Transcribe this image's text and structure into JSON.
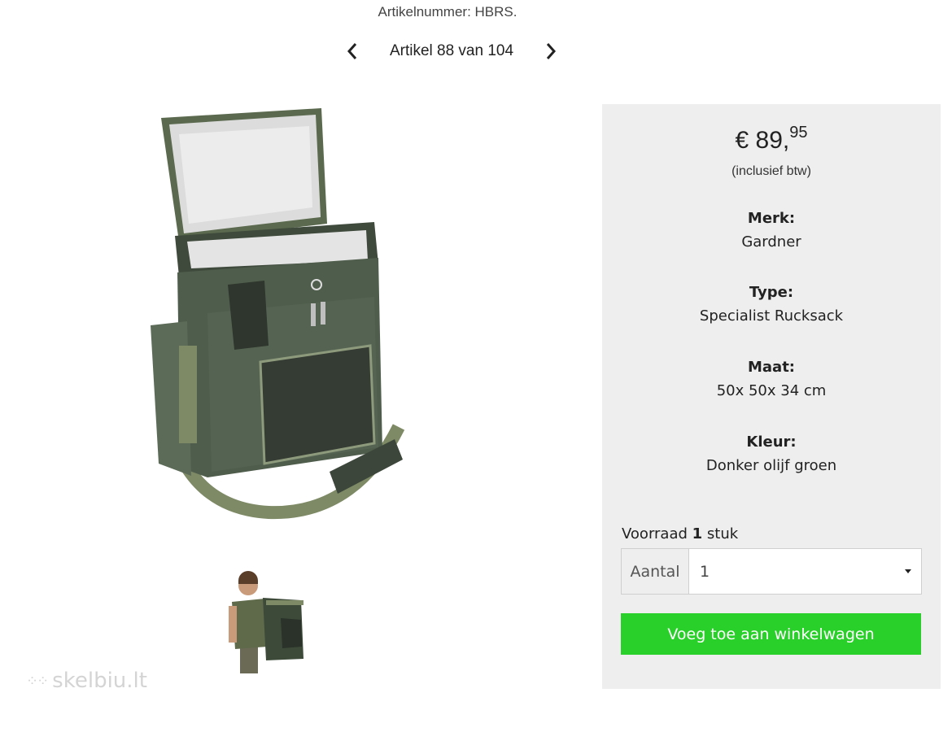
{
  "header": {
    "sku": "Artikelnummer: HBRS.",
    "pager_label": "Artikel 88 van 104"
  },
  "price": {
    "main": "€ 89,",
    "cents": "95",
    "vat_note": "(inclusief btw)"
  },
  "attributes": [
    {
      "key": "Merk:",
      "value": "Gardner"
    },
    {
      "key": "Type:",
      "value": "Specialist Rucksack"
    },
    {
      "key": "Maat:",
      "value": "50x 50x 34 cm"
    },
    {
      "key": "Kleur:",
      "value": "Donker olijf groen"
    }
  ],
  "stock": {
    "prefix": "Voorraad ",
    "count": "1",
    "unit": " stuk"
  },
  "quantity": {
    "label": "Aantal",
    "selected": "1"
  },
  "cart_button": "Voeg toe aan winkelwagen",
  "watermark": "skelbiu.lt",
  "colors": {
    "panel_bg": "#eeeeee",
    "button_green": "#2ad02a",
    "bag_green": "#4a5a4a"
  }
}
